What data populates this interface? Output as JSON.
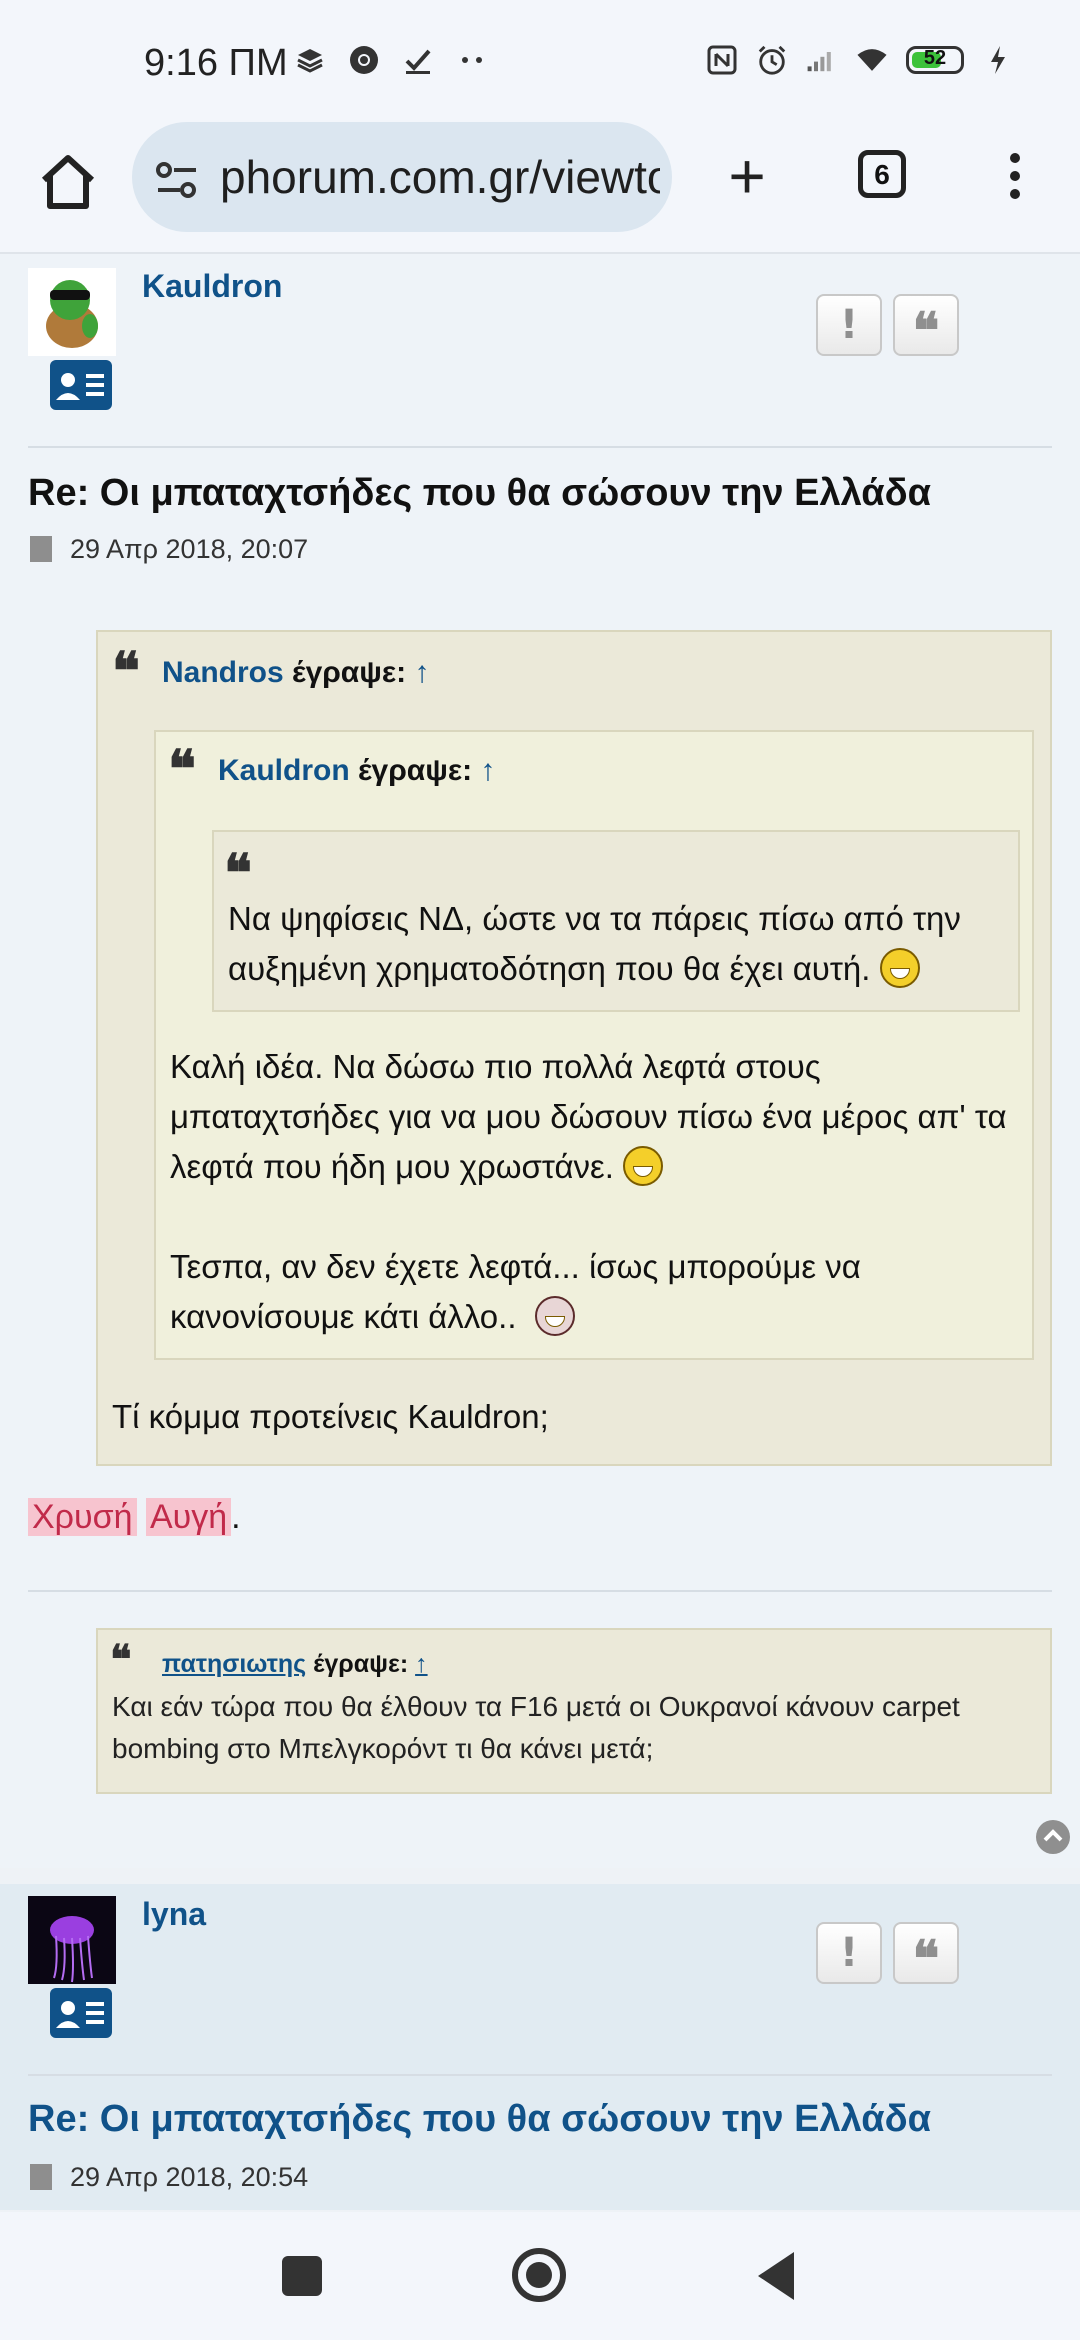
{
  "status_bar": {
    "time": "9:16 ΠΜ",
    "battery": "52",
    "icons_left": [
      "layers-icon",
      "chrome-icon",
      "check-icon",
      "more-dots-icon"
    ],
    "icons_right": [
      "nfc-icon",
      "alarm-icon",
      "signal-icon",
      "wifi-icon",
      "battery-icon",
      "charging-icon"
    ]
  },
  "browser": {
    "url": "phorum.com.gr/viewtopic",
    "tab_count": "6"
  },
  "post1": {
    "username": "Kauldron",
    "report_label": "!",
    "quote_label": "❝",
    "title": "Re: Οι μπαταχτσήδες που θα σώσουν την Ελλάδα",
    "date": "29 Απρ 2018, 20:07",
    "quote1": {
      "author": "Nandros",
      "wrote": "έγραψε:",
      "arrow": "↑",
      "nested": {
        "author": "Kauldron",
        "wrote": "έγραψε:",
        "arrow": "↑",
        "inner_text": "Να ψηφίσεις ΝΔ, ώστε να τα πάρεις πίσω από την αυξημένη χρηματοδότηση που θα έχει αυτή.",
        "text1": "Καλή ιδέα. Να δώσω πιο πολλά λεφτά στους μπαταχτσήδες για να μου δώσουν πίσω ένα μέρος απ' τα λεφτά που ήδη μου χρωστάνε.",
        "text2": "Τεσπα, αν δεν έχετε λεφτά... ίσως μπορούμε να κανονίσουμε κάτι άλλο.."
      },
      "reply": "Τί κόμμα προτείνεις Kauldron;"
    },
    "sig_line": {
      "word1": "Χρυσή",
      "word2": "Αυγή",
      "end": "."
    },
    "signature_quote": {
      "author": "πατησιωτης",
      "wrote": "έγραψε:",
      "arrow": "↑",
      "text": "Και εάν τώρα που θα έλθουν τα F16 μετά οι Ουκρανοί κάνουν carpet bombing στο Μπελγκορόντ τι θα κάνει μετά;"
    }
  },
  "post2": {
    "username": "lyna",
    "report_label": "!",
    "quote_label": "❝",
    "title": "Re: Οι μπαταχτσήδες που θα σώσουν την Ελλάδα",
    "date": "29 Απρ 2018, 20:54"
  },
  "colors": {
    "link_blue": "#105289",
    "quote_bg": "#ebe9d9",
    "highlight_bg": "#f7c4cf",
    "highlight_text": "#c12a4a"
  }
}
